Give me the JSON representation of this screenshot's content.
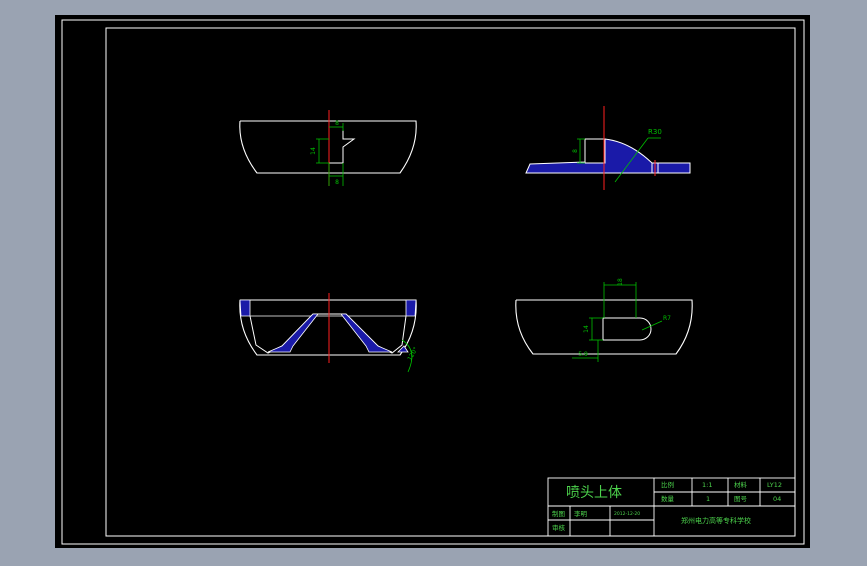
{
  "colors": {
    "background": "#9aa3b2",
    "paper": "#000000",
    "frame": "#ffffff",
    "dimension": "#00c000",
    "centerline": "#ff2020",
    "hatch_fill": "#1a1aa8",
    "title_green": "#4cd34c"
  },
  "views": {
    "top_left": {
      "dim_width": "8",
      "dim_height": "14",
      "dim_bottom": "8"
    },
    "top_right": {
      "dim_height": "8",
      "dim_radius": "R30"
    },
    "bottom_left": {
      "dim_angle": "120°"
    },
    "bottom_right": {
      "dim_width": "18",
      "dim_height": "14",
      "dim_offset": "5.9",
      "dim_radius": "R7"
    }
  },
  "title_block": {
    "part_name": "喷头上体",
    "scale_label": "比例",
    "scale_value": "1:1",
    "material_label": "材料",
    "material_value": "LY12",
    "quantity_label": "数量",
    "quantity_value": "1",
    "drawing_no_label": "图号",
    "drawing_no_value": "04",
    "drawn_label": "制图",
    "designer_name": "李明",
    "date": "2012-12-20",
    "review_label": "审核",
    "school": "郑州电力高等专科学校"
  }
}
